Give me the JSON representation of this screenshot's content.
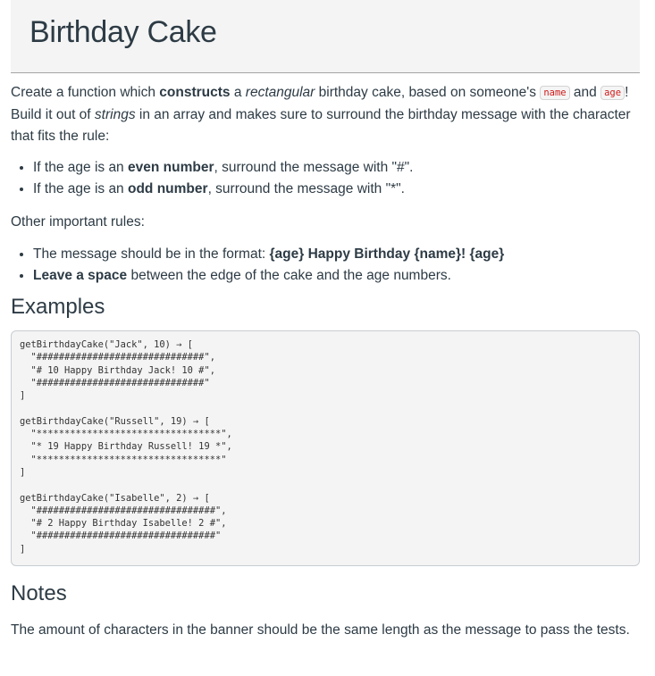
{
  "header": {
    "title": "Birthday Cake"
  },
  "intro": {
    "t1": "Create a function which ",
    "b1": "constructs",
    "t2": " a ",
    "i1": "rectangular",
    "t3": " birthday cake, based on someone's ",
    "code1": "name",
    "t4": " and ",
    "code2": "age",
    "t5": "! Build it out of ",
    "i2": "strings",
    "t6": " in an array and makes sure to surround the birthday message with the character that fits the rule:"
  },
  "rules": [
    {
      "pre": "If the age is an ",
      "bold": "even number",
      "post": ", surround the message with \"#\"."
    },
    {
      "pre": "If the age is an ",
      "bold": "odd number",
      "post": ", surround the message with \"*\"."
    }
  ],
  "other_label": "Other important rules:",
  "other_rules": [
    {
      "pre": "The message should be in the format: ",
      "bold": "{age} Happy Birthday {name}! {age}",
      "post": ""
    },
    {
      "pre": "",
      "bold": "Leave a space",
      "post": " between the edge of the cake and the age numbers."
    }
  ],
  "examples_heading": "Examples",
  "examples": [
    {
      "call": "getBirthdayCake(\"Jack\", 10) → [",
      "lines": [
        "  \"##############################\",",
        "  \"# 10 Happy Birthday Jack! 10 #\",",
        "  \"##############################\""
      ],
      "close": "]"
    },
    {
      "call": "getBirthdayCake(\"Russell\", 19) → [",
      "lines": [
        "  \"*********************************\",",
        "  \"* 19 Happy Birthday Russell! 19 *\",",
        "  \"*********************************\""
      ],
      "close": "]"
    },
    {
      "call": "getBirthdayCake(\"Isabelle\", 2) → [",
      "lines": [
        "  \"################################\",",
        "  \"# 2 Happy Birthday Isabelle! 2 #\",",
        "  \"################################\""
      ],
      "close": "]"
    }
  ],
  "notes_heading": "Notes",
  "notes_text": "The amount of characters in the banner should be the same length as the message to pass the tests."
}
